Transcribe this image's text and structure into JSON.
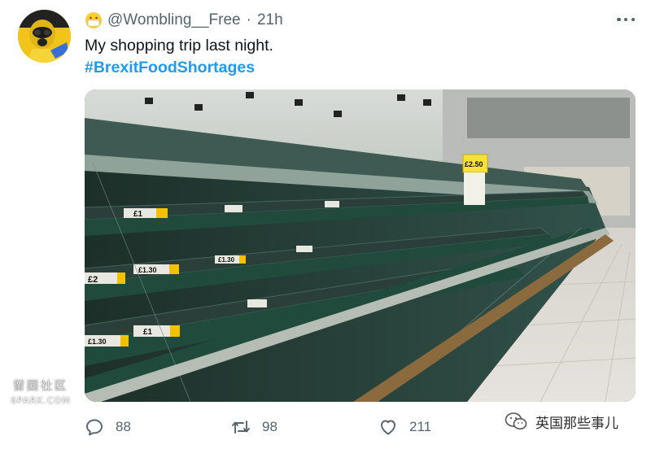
{
  "tweet": {
    "username": "@Wombling__Free",
    "separator": "·",
    "time": "21h",
    "text": "My shopping trip last night.",
    "hashtag": "#BrexitFoodShortages",
    "avatar_icon": "hazmat-mask-avatar",
    "username_emoji": "face-with-mask-emoji",
    "photo": {
      "description_icon": "empty-supermarket-shelves-photo",
      "price_labels": [
        "£1",
        "£1.30",
        "£2",
        "£1",
        "£1.30",
        "£1.30"
      ],
      "sign_text": "£2.50"
    }
  },
  "actions": {
    "reply_count": "88",
    "retweet_count": "98",
    "like_count": "211"
  },
  "watermarks": {
    "left_cn": "留园社区",
    "left_en": "6PARK.COM",
    "right_cn": "英国那些事儿"
  },
  "colors": {
    "link": "#1d9bf0",
    "muted": "#536471",
    "text": "#0f1419"
  }
}
